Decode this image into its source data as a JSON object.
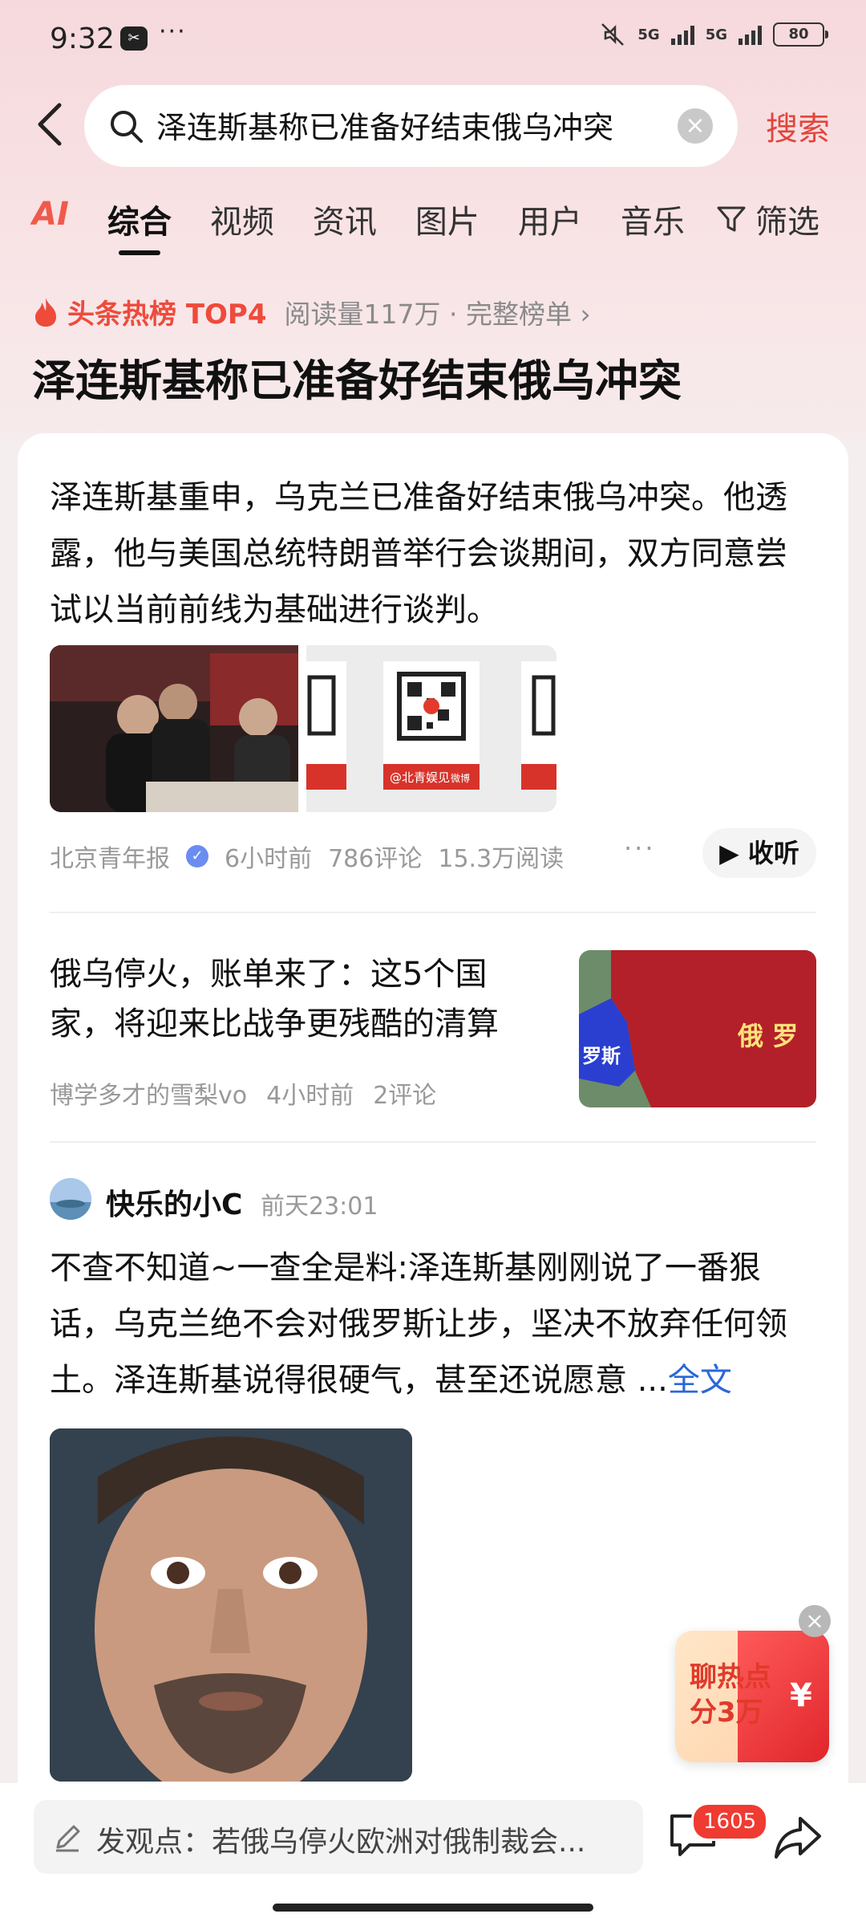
{
  "status_bar": {
    "time": "9:32",
    "app_badge": "✂",
    "network_1": "5G",
    "network_2": "5G",
    "battery": "80"
  },
  "search": {
    "query": "泽连斯基称已准备好结束俄乌冲突",
    "button": "搜索"
  },
  "tabs": [
    "AI",
    "综合",
    "视频",
    "资讯",
    "图片",
    "用户",
    "音乐"
  ],
  "filter_label": "筛选",
  "hot": {
    "label": "头条热榜 TOP4",
    "meta": "阅读量117万 · 完整榜单 ›",
    "title": "泽连斯基称已准备好结束俄乌冲突"
  },
  "article1": {
    "text": "泽连斯基重申，乌克兰已准备好结束俄乌冲突。他透露，他与美国总统特朗普举行会谈期间，双方同意尝试以当前前线为基础进行谈判。",
    "source": "北京青年报",
    "time": "6小时前",
    "comments": "786评论",
    "reads": "15.3万阅读",
    "listen": "▶ 收听",
    "qr_caption": "@北青娱见",
    "qr_tag": "微博"
  },
  "article2": {
    "title": "俄乌停火，账单来了：这5个国家，将迎来比战争更残酷的清算",
    "author": "博学多才的雪梨vo",
    "time": "4小时前",
    "comments": "2评论",
    "map_label_left": "罗斯",
    "map_label_right": "俄 罗"
  },
  "post": {
    "author": "快乐的小C",
    "time": "前天23:01",
    "text": "不查不知道~一查全是料:泽连斯基刚刚说了一番狠话，乌克兰绝不会对俄罗斯让步，坚决不放弃任何领土。泽连斯基说得很硬气，甚至还说愿意",
    "ellipsis": "...",
    "full": "全文"
  },
  "promo": {
    "line1": "聊热点",
    "line2": "分3万",
    "yen": "¥"
  },
  "bottom": {
    "comment_placeholder": "发观点：若俄乌停火欧洲对俄制裁会...",
    "comment_count": "1605"
  }
}
